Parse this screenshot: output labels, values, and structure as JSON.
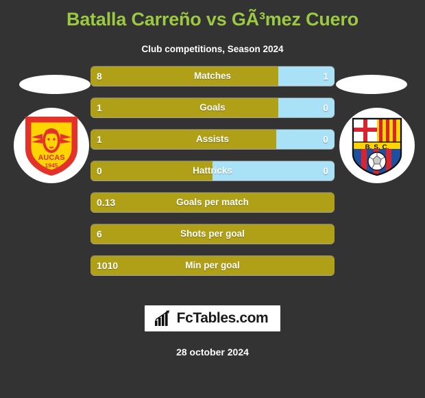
{
  "header": {
    "title": "Batalla Carreño vs GÃ³mez Cuero",
    "subtitle": "Club competitions, Season 2024"
  },
  "teams": {
    "home": {
      "crest_name": "aucas-crest",
      "crest_text": "AUCAS",
      "crest_year": "1945"
    },
    "away": {
      "crest_name": "barcelona-sc-crest",
      "crest_text": "B. S. C."
    }
  },
  "footer": {
    "brand": "FcTables.com",
    "brand_icon": "bar-chart-arrow-icon",
    "date": "28 october 2024"
  },
  "colors": {
    "background": "#333333",
    "title": "#9BC93F",
    "home_bar": "#B0A017",
    "away_bar": "#A9E1F7",
    "text": "#ffffff"
  },
  "chart_data": {
    "type": "bar",
    "title": "Batalla Carreño vs GÃ³mez Cuero",
    "subtitle": "Club competitions, Season 2024",
    "orientation": "horizontal-diverging",
    "xlabel": "",
    "ylabel": "",
    "grid": false,
    "legend_position": "none",
    "series": [
      {
        "name": "Batalla Carreño",
        "side": "left",
        "color": "#B0A017",
        "values": [
          8,
          1,
          1,
          0,
          0.13,
          6,
          1010
        ]
      },
      {
        "name": "GÃ³mez Cuero",
        "side": "right",
        "color": "#A9E1F7",
        "values": [
          1,
          0,
          0,
          0,
          null,
          null,
          null
        ]
      }
    ],
    "categories": [
      "Matches",
      "Goals",
      "Assists",
      "Hattricks",
      "Goals per match",
      "Shots per goal",
      "Min per goal"
    ],
    "rows": [
      {
        "label": "Matches",
        "home": "8",
        "away": "1",
        "home_pct": 77,
        "has_away": true
      },
      {
        "label": "Goals",
        "home": "1",
        "away": "0",
        "home_pct": 77,
        "has_away": true
      },
      {
        "label": "Assists",
        "home": "1",
        "away": "0",
        "home_pct": 76,
        "has_away": true
      },
      {
        "label": "Hattricks",
        "home": "0",
        "away": "0",
        "home_pct": 50,
        "has_away": true
      },
      {
        "label": "Goals per match",
        "home": "0.13",
        "away": "",
        "home_pct": 100,
        "has_away": false
      },
      {
        "label": "Shots per goal",
        "home": "6",
        "away": "",
        "home_pct": 100,
        "has_away": false
      },
      {
        "label": "Min per goal",
        "home": "1010",
        "away": "",
        "home_pct": 100,
        "has_away": false
      }
    ]
  }
}
